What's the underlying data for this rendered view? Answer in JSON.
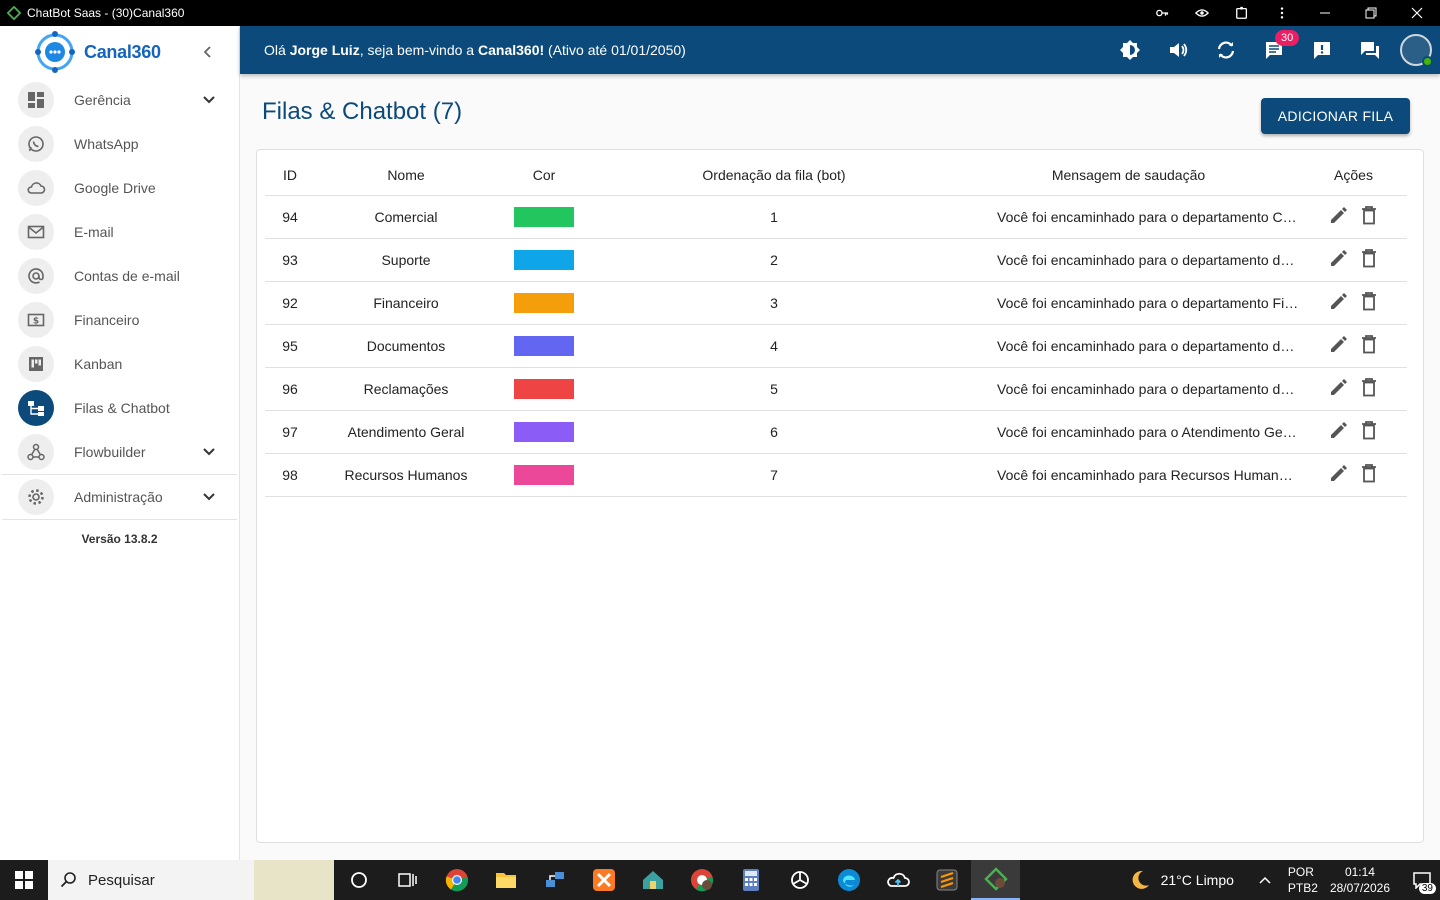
{
  "window": {
    "title": "ChatBot Saas - (30)Canal360"
  },
  "brand": {
    "logo_text": "Canal360",
    "accent": "#0b4a7a"
  },
  "sidebar": {
    "items": [
      {
        "label": "Gerência",
        "icon": "dashboard-icon",
        "chevron": true
      },
      {
        "label": "WhatsApp",
        "icon": "whatsapp-icon"
      },
      {
        "label": "Google Drive",
        "icon": "cloud-icon"
      },
      {
        "label": "E-mail",
        "icon": "mail-icon"
      },
      {
        "label": "Contas de e-mail",
        "icon": "at-icon"
      },
      {
        "label": "Financeiro",
        "icon": "money-icon"
      },
      {
        "label": "Kanban",
        "icon": "kanban-icon"
      },
      {
        "label": "Filas & Chatbot",
        "icon": "flow-icon",
        "active": true
      },
      {
        "label": "Flowbuilder",
        "icon": "webhook-icon",
        "chevron": true
      },
      {
        "label": "Administração",
        "icon": "gear-icon",
        "chevron": true
      }
    ],
    "version": "Versão 13.8.2"
  },
  "header": {
    "greeting_prefix": "Olá ",
    "user_name": "Jorge Luiz",
    "greeting_mid": ", seja bem-vindo a ",
    "company": "Canal360!",
    "greeting_suffix": " (Ativo até 01/01/2050)",
    "badge_count": "30"
  },
  "main": {
    "title": "Filas & Chatbot (7)",
    "add_button": "ADICIONAR FILA",
    "columns": [
      "ID",
      "Nome",
      "Cor",
      "Ordenação da fila (bot)",
      "Mensagem de saudação",
      "Ações"
    ],
    "rows": [
      {
        "id": "94",
        "name": "Comercial",
        "color": "#22c55e",
        "order": "1",
        "message": "Você foi encaminhado para o departamento Comercial. Em breve um atendente irá lhe responder."
      },
      {
        "id": "93",
        "name": "Suporte",
        "color": "#0ea5e9",
        "order": "2",
        "message": "Você foi encaminhado para o departamento de Suporte. Em breve um atendente irá lhe responder."
      },
      {
        "id": "92",
        "name": "Financeiro",
        "color": "#f59e0b",
        "order": "3",
        "message": "Você foi encaminhado para o departamento Financeiro. Em breve um atendente irá lhe responder."
      },
      {
        "id": "95",
        "name": "Documentos",
        "color": "#6366f1",
        "order": "4",
        "message": "Você foi encaminhado para o departamento de Documentos. Em breve um atendente irá lhe responder."
      },
      {
        "id": "96",
        "name": "Reclamações",
        "color": "#ef4444",
        "order": "5",
        "message": "Você foi encaminhado para o departamento de Reclamações. Em breve um atendente irá lhe responder."
      },
      {
        "id": "97",
        "name": "Atendimento Geral",
        "color": "#8b5cf6",
        "order": "6",
        "message": "Você foi encaminhado para o Atendimento Geral. Em breve um atendente irá lhe responder."
      },
      {
        "id": "98",
        "name": "Recursos Humanos",
        "color": "#ec4899",
        "order": "7",
        "message": "Você foi encaminhado para Recursos Humanos. Em breve um atendente irá lhe responder."
      }
    ]
  },
  "taskbar": {
    "search_placeholder": "Pesquisar",
    "weather": "21°C  Limpo",
    "lang_1": "POR",
    "lang_2": "PTB2",
    "time": "01:14",
    "date": "28/07/2026",
    "notif_count": "39"
  }
}
